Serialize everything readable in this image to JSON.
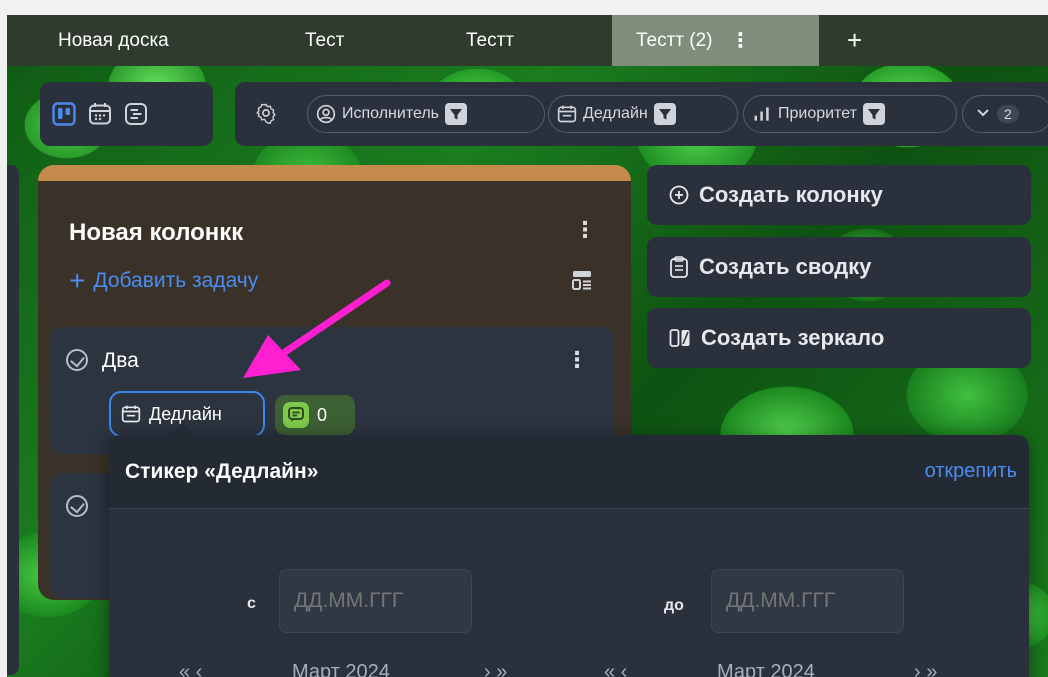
{
  "tabs": [
    {
      "label": "Новая доска"
    },
    {
      "label": "Тест"
    },
    {
      "label": "Тестт"
    },
    {
      "label": "Тестт (2)",
      "active": true
    }
  ],
  "tab_add_label": "+",
  "toolbar": {
    "views": [
      "board-view-icon",
      "calendar-view-icon",
      "list-view-icon"
    ],
    "filters": {
      "assignee": "Исполнитель",
      "deadline": "Дедлайн",
      "priority": "Приоритет",
      "more_count": "2"
    }
  },
  "column": {
    "title": "Новая колонкк",
    "add_task": "Добавить задачу",
    "accent": "#c48b4d",
    "cards": [
      {
        "title": "Два",
        "deadline_sticker": "Дедлайн",
        "comments": "0"
      }
    ]
  },
  "actions": {
    "create_column": "Создать колонку",
    "create_summary": "Создать сводку",
    "create_mirror": "Создать зеркало"
  },
  "popup": {
    "title": "Стикер «Дедлайн»",
    "unpin": "открепить",
    "from_label": "с",
    "to_label": "до",
    "from_placeholder": "ДД.ММ.ГГГ",
    "to_placeholder": "ДД.ММ.ГГГ",
    "calendar_left": {
      "month": "Март 2024",
      "prev": "« ‹",
      "next": "› »"
    },
    "calendar_right": {
      "month": "Март 2024",
      "prev": "« ‹",
      "next": "› »"
    }
  },
  "colors": {
    "accent_blue": "#4a8cf0",
    "annotation_arrow": "#ff1fd1",
    "panel": "#2a313c"
  }
}
